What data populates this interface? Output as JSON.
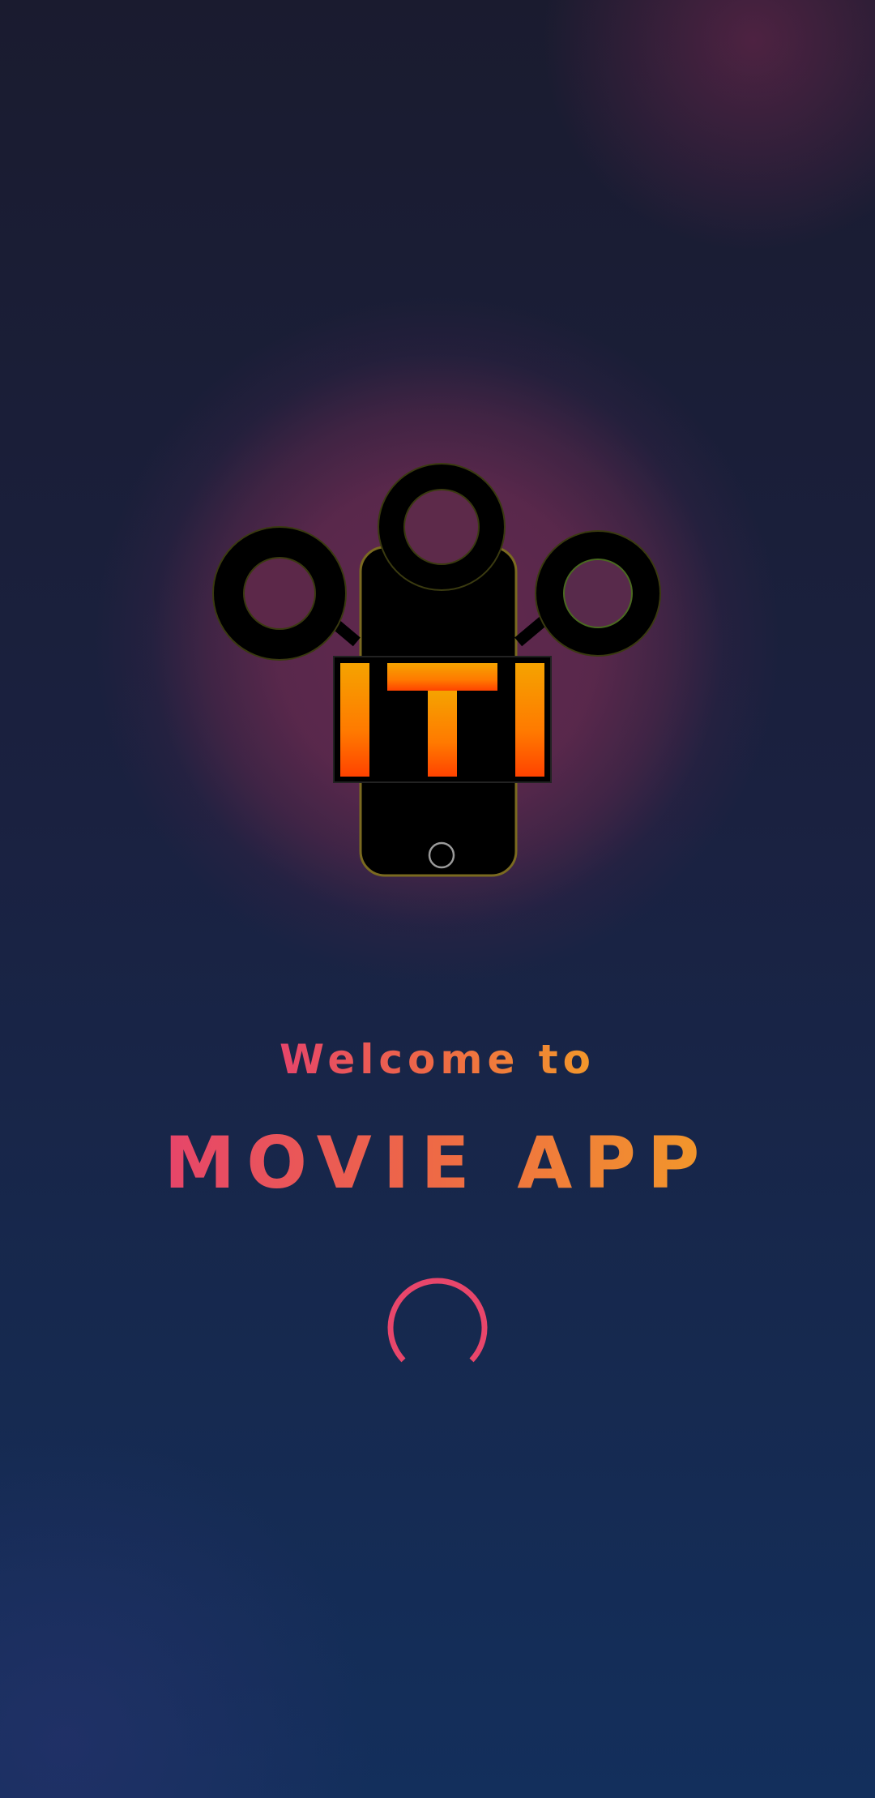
{
  "splash": {
    "welcome_text": "Welcome to",
    "app_title": "MOVIE APP",
    "logo_text": "ITI",
    "loading_indicator": "spinner"
  },
  "colors": {
    "background_top": "#1a1b2f",
    "background_bottom": "#132f5c",
    "glow": "#5c284c",
    "text_gradient_start": "#e6456a",
    "text_gradient_end": "#f2982a",
    "spinner": "#e8466b",
    "logo_fill_top": "#f5a300",
    "logo_fill_bottom": "#ff4a00"
  },
  "icons": {
    "logo": "iti-film-camera-logo",
    "loader": "loading-spinner-icon"
  }
}
